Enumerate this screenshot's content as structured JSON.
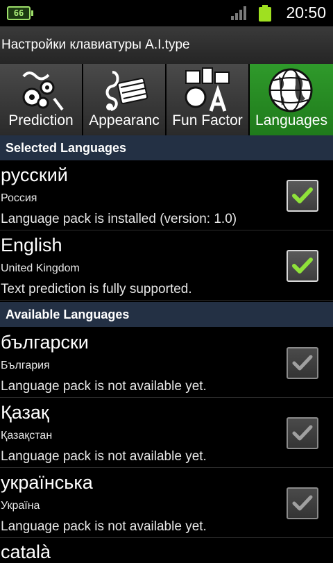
{
  "status_bar": {
    "app_badge": "66",
    "time": "20:50",
    "icons": [
      "app-badge-icon",
      "signal-icon",
      "battery-icon"
    ]
  },
  "title_bar": {
    "title": "Настройки клавиатуры A.I.type"
  },
  "tabs": [
    {
      "label": "Prediction",
      "icon": "gears-icon",
      "active": false
    },
    {
      "label": "Appearanc",
      "icon": "music-keyboard-icon",
      "active": false
    },
    {
      "label": "Fun Factor",
      "icon": "fun-letters-icon",
      "active": false
    },
    {
      "label": "Languages",
      "icon": "globe-icon",
      "active": true
    }
  ],
  "selected_section": {
    "header": "Selected Languages",
    "items": [
      {
        "name": "русский",
        "country": "Россия",
        "status": "Language pack is installed (version: 1.0)",
        "checked": true,
        "enabled": true
      },
      {
        "name": "English",
        "country": "United Kingdom",
        "status": "Text prediction is fully supported.",
        "checked": true,
        "enabled": true
      }
    ]
  },
  "available_section": {
    "header": "Available Languages",
    "items": [
      {
        "name": "български",
        "country": "България",
        "status": "Language pack is not available yet.",
        "checked": true,
        "enabled": false
      },
      {
        "name": "Қазақ",
        "country": "Қазақстан",
        "status": "Language pack is not available yet.",
        "checked": true,
        "enabled": false
      },
      {
        "name": "українська",
        "country": "Україна",
        "status": "Language pack is not available yet.",
        "checked": true,
        "enabled": false
      },
      {
        "name": "català",
        "country": "",
        "status": "",
        "checked": false,
        "enabled": false
      }
    ]
  },
  "colors": {
    "active_tab": "#2f9a2b",
    "section_header_bg": "#233044",
    "check_enabled": "#8fe23a",
    "check_disabled": "#a0a0a0"
  }
}
